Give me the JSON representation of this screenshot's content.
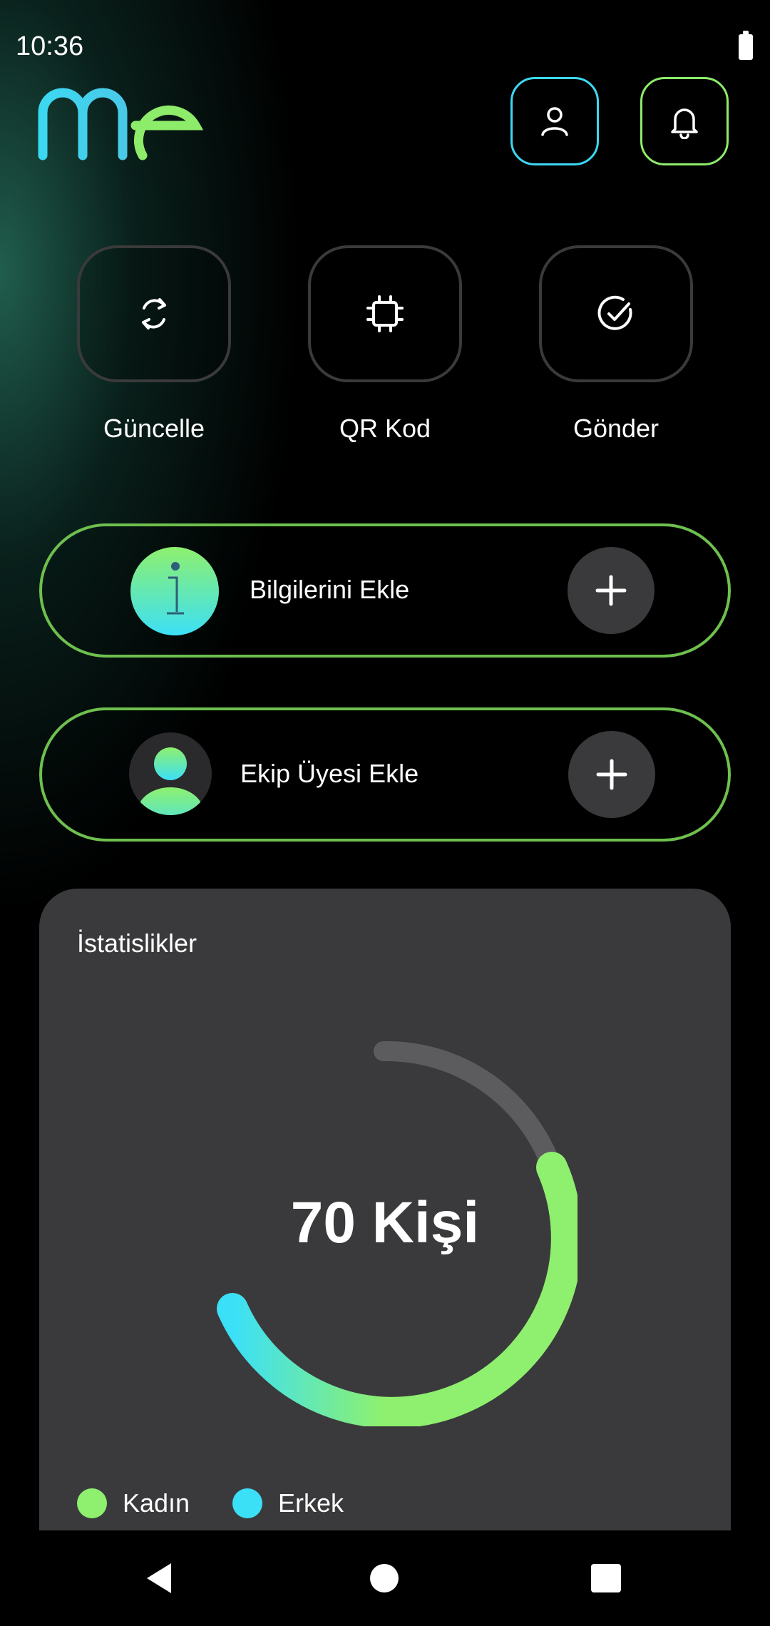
{
  "status_bar": {
    "time": "10:36"
  },
  "header": {
    "logo_icon": "me-logo",
    "profile_icon": "user-icon",
    "notifications_icon": "bell-icon"
  },
  "actions": [
    {
      "label": "Güncelle",
      "icon": "refresh-icon"
    },
    {
      "label": "QR Kod",
      "icon": "chip-icon"
    },
    {
      "label": "Gönder",
      "icon": "check-circle-icon"
    }
  ],
  "cards": [
    {
      "label": "Bilgilerini Ekle",
      "icon": "info-icon"
    },
    {
      "label": "Ekip Üyesi Ekle",
      "icon": "team-member-icon"
    }
  ],
  "stats": {
    "title": "İstatislikler",
    "center_value": "70 Kişi",
    "legend": [
      {
        "label": "Kadın",
        "color": "#8ef06e"
      },
      {
        "label": "Erkek",
        "color": "#3ce0f6"
      }
    ]
  },
  "colors": {
    "accent_green": "#8ef06e",
    "accent_cyan": "#3cd8f2",
    "card_bg": "#3a3a3c"
  },
  "nav": {
    "back_icon": "back-icon",
    "home_icon": "home-icon",
    "recents_icon": "recents-icon"
  }
}
